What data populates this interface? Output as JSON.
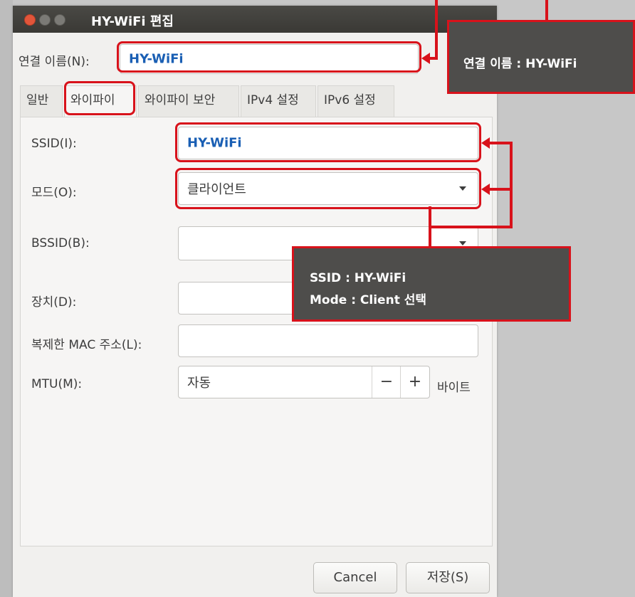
{
  "window": {
    "title": "HY-WiFi 편집"
  },
  "connection_name": {
    "label": "연결 이름(N):",
    "value": "HY-WiFi"
  },
  "tabs": [
    {
      "label": "일반",
      "active": false
    },
    {
      "label": "와이파이",
      "active": true
    },
    {
      "label": "와이파이 보안",
      "active": false
    },
    {
      "label": "IPv4 설정",
      "active": false
    },
    {
      "label": "IPv6 설정",
      "active": false
    }
  ],
  "form": {
    "ssid": {
      "label": "SSID(I):",
      "value": "HY-WiFi"
    },
    "mode": {
      "label": "모드(O):",
      "value": "클라이언트"
    },
    "bssid": {
      "label": "BSSID(B):",
      "value": ""
    },
    "device": {
      "label": "장치(D):",
      "value": ""
    },
    "cloned_mac": {
      "label": "복제한 MAC 주소(L):",
      "value": ""
    },
    "mtu": {
      "label": "MTU(M):",
      "value": "자동",
      "minus": "−",
      "plus": "+",
      "unit": "바이트"
    }
  },
  "buttons": {
    "cancel": "Cancel",
    "save": "저장(S)"
  },
  "annotations": {
    "top": "연결 이름 : HY-WiFi",
    "middle_line1": "SSID : HY-WiFi",
    "middle_line2": "Mode : Client 선택",
    "highlight_color": "#d8121b",
    "callout_bg": "#4e4d4b"
  }
}
